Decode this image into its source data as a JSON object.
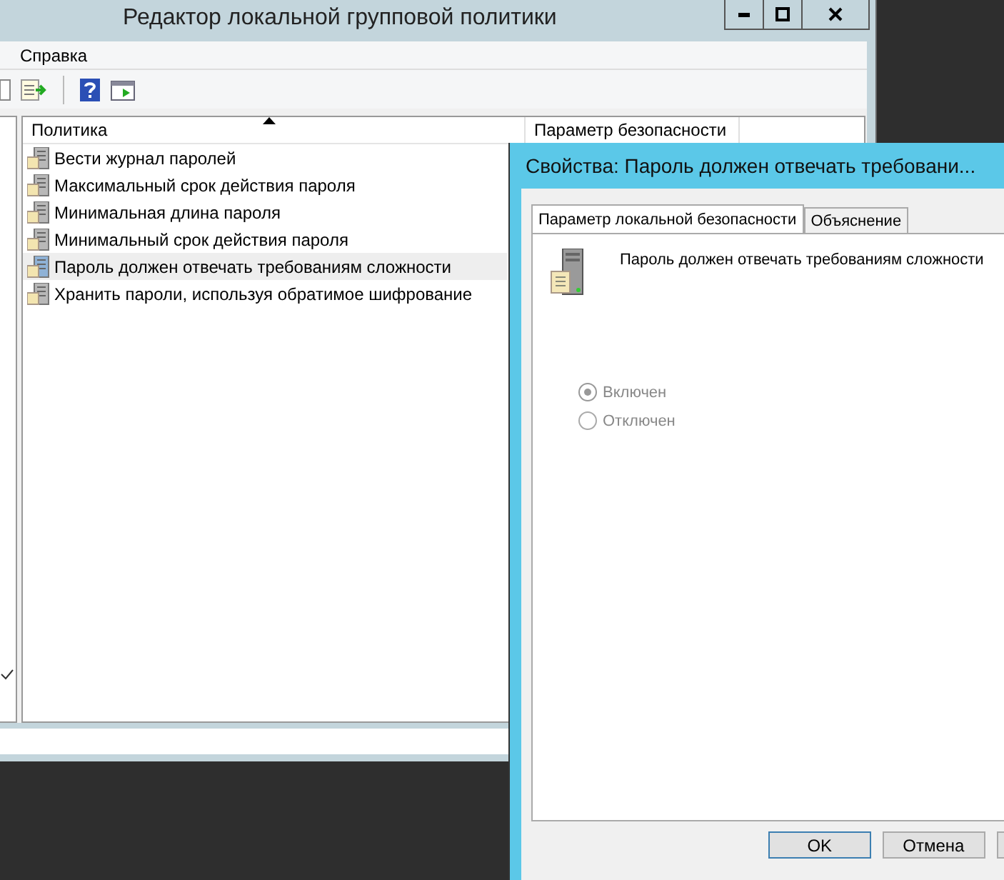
{
  "window": {
    "title": "Редактор локальной групповой политики"
  },
  "menu": [
    {
      "label": "Справка"
    }
  ],
  "table": {
    "columns": [
      {
        "label": "Политика",
        "sorted": true
      },
      {
        "label": "Параметр безопасности",
        "sorted": false
      }
    ],
    "rows": [
      {
        "name": "Вести журнал паролей",
        "selected": false
      },
      {
        "name": "Максимальный срок действия пароля",
        "selected": false
      },
      {
        "name": "Минимальная длина пароля",
        "selected": false
      },
      {
        "name": "Минимальный срок действия пароля",
        "selected": false
      },
      {
        "name": "Пароль должен отвечать требованиям сложности",
        "selected": true
      },
      {
        "name": "Хранить пароли, используя обратимое шифрование",
        "selected": false
      }
    ]
  },
  "dialog": {
    "title": "Свойства: Пароль должен отвечать требовани...",
    "tabs": [
      {
        "label": "Параметр локальной безопасности",
        "selected": true
      },
      {
        "label": "Объяснение",
        "selected": false
      }
    ],
    "policy_name": "Пароль должен отвечать требованиям сложности",
    "options": [
      {
        "label": "Включен",
        "selected": true,
        "disabled": true
      },
      {
        "label": "Отключен",
        "selected": false,
        "disabled": true
      }
    ],
    "buttons": [
      {
        "label": "OK",
        "default": true
      },
      {
        "label": "Отмена",
        "default": false
      }
    ]
  }
}
